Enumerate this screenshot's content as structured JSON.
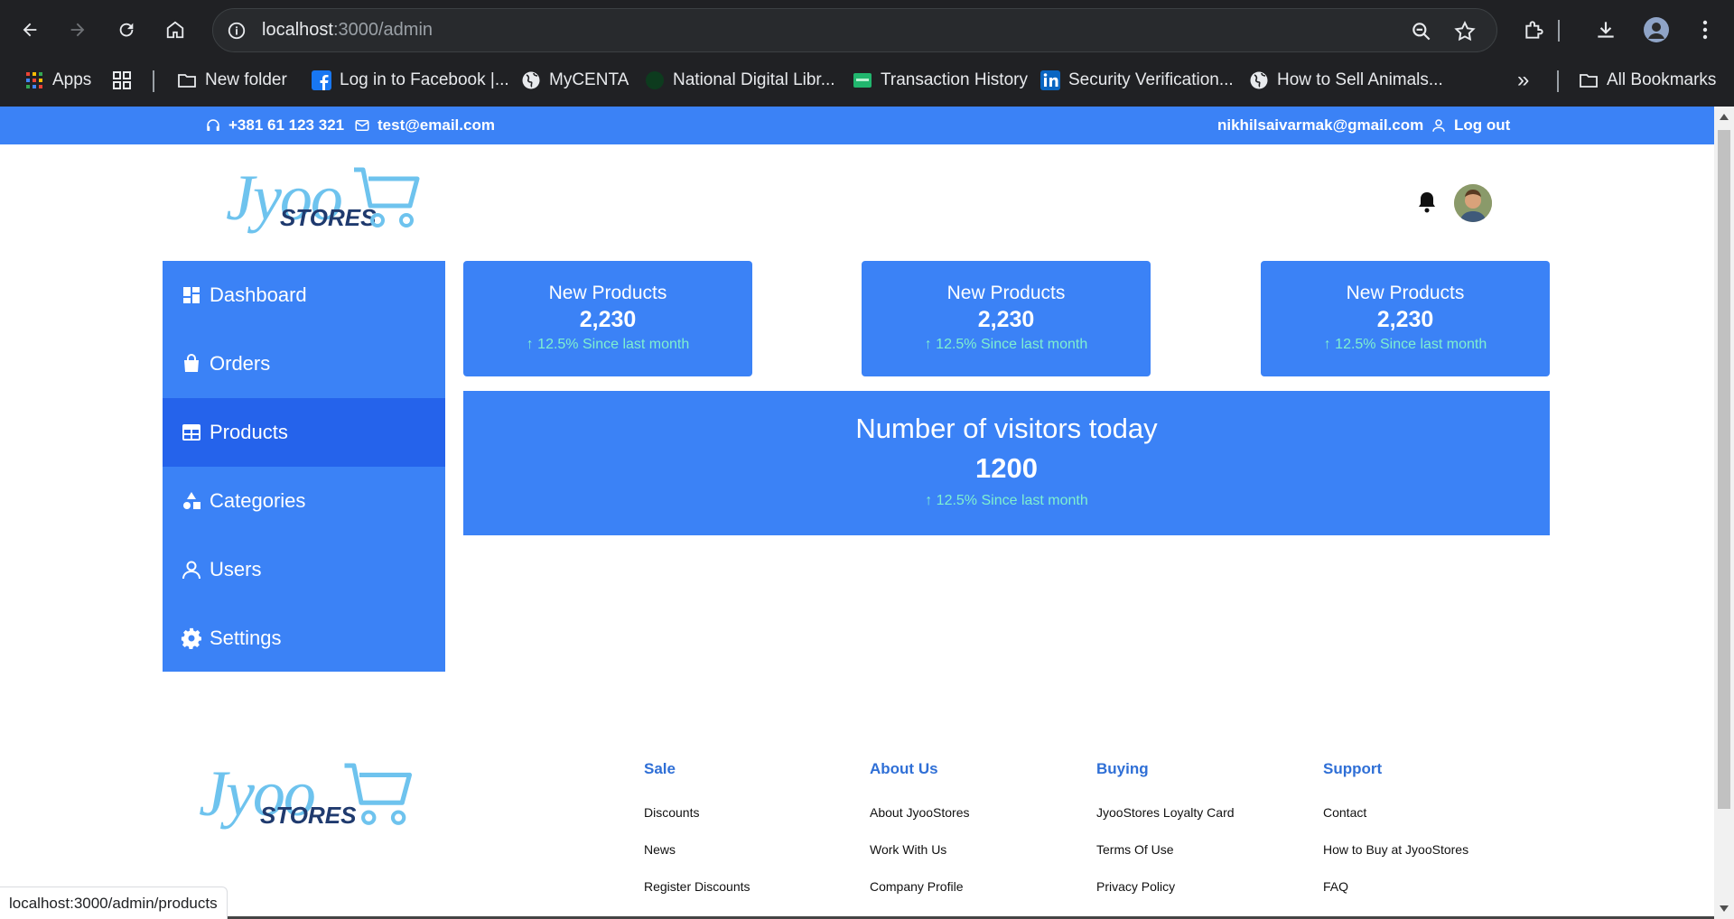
{
  "browser": {
    "url_host": "localhost",
    "url_path": ":3000/admin",
    "bookmarks": [
      {
        "label": "Apps",
        "icon": "apps-grid-icon"
      },
      {
        "label": "",
        "icon": "tab-groups-icon"
      },
      {
        "label": "New folder",
        "icon": "folder-icon"
      },
      {
        "label": "Log in to Facebook |...",
        "icon": "facebook-icon"
      },
      {
        "label": "MyCENTA",
        "icon": "globe-icon"
      },
      {
        "label": "National Digital Libr...",
        "icon": "ndl-icon"
      },
      {
        "label": "Transaction History",
        "icon": "sheet-icon"
      },
      {
        "label": "Security Verification...",
        "icon": "linkedin-icon"
      },
      {
        "label": "How to Sell Animals...",
        "icon": "globe-icon"
      }
    ],
    "overflow_label": "»",
    "all_bookmarks_label": "All Bookmarks",
    "status_url": "localhost:3000/admin/products"
  },
  "topbar": {
    "phone": "+381 61 123 321",
    "email": "test@email.com",
    "user_email": "nikhilsaivarmak@gmail.com",
    "logout": "Log out"
  },
  "logo": {
    "main": "Jyoo",
    "sub": "STORES"
  },
  "sidebar": {
    "items": [
      {
        "label": "Dashboard",
        "icon": "dashboard-icon"
      },
      {
        "label": "Orders",
        "icon": "shopping-bag-icon"
      },
      {
        "label": "Products",
        "icon": "table-icon",
        "active": true
      },
      {
        "label": "Categories",
        "icon": "shapes-icon"
      },
      {
        "label": "Users",
        "icon": "user-icon"
      },
      {
        "label": "Settings",
        "icon": "gear-icon"
      }
    ]
  },
  "stats": [
    {
      "label": "New Products",
      "value": "2,230",
      "change": "↑ 12.5% Since last month"
    },
    {
      "label": "New Products",
      "value": "2,230",
      "change": "↑ 12.5% Since last month"
    },
    {
      "label": "New Products",
      "value": "2,230",
      "change": "↑ 12.5% Since last month"
    }
  ],
  "visitors": {
    "label": "Number of visitors today",
    "value": "1200",
    "change": "↑ 12.5% Since last month"
  },
  "footer": {
    "columns": [
      {
        "head": "Sale",
        "links": [
          "Discounts",
          "News",
          "Register Discounts"
        ]
      },
      {
        "head": "About Us",
        "links": [
          "About JyooStores",
          "Work With Us",
          "Company Profile"
        ]
      },
      {
        "head": "Buying",
        "links": [
          "JyooStores Loyalty Card",
          "Terms Of Use",
          "Privacy Policy"
        ]
      },
      {
        "head": "Support",
        "links": [
          "Contact",
          "How to Buy at JyooStores",
          "FAQ"
        ]
      }
    ]
  },
  "colors": {
    "primary": "#3b82f6",
    "active": "#2563eb",
    "accent_text": "#7ff0d0",
    "footer_head": "#2f6fd6"
  }
}
